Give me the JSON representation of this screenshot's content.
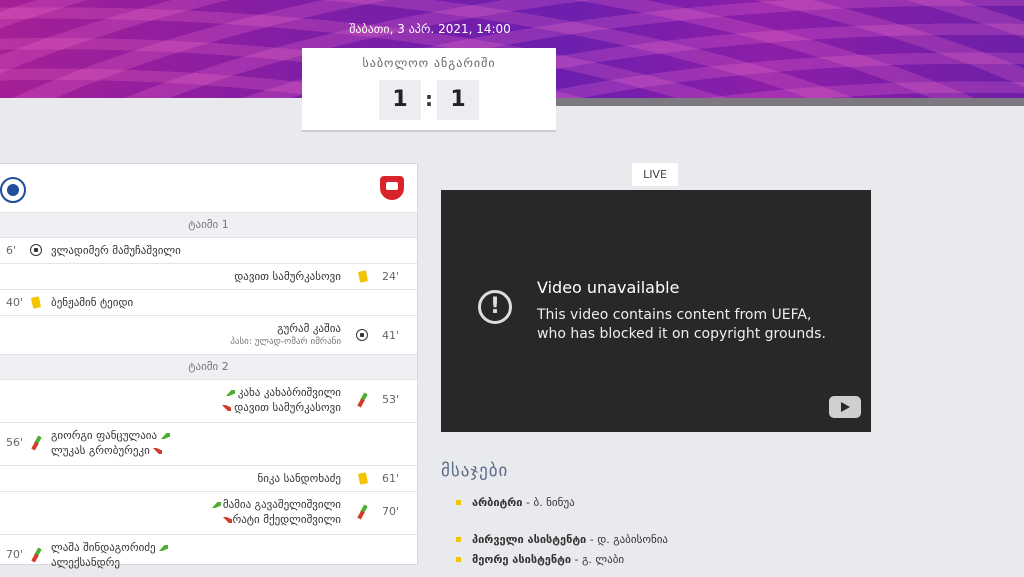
{
  "header": {
    "date": "შაბათი, 3 აპრ. 2021, 14:00",
    "score_title": "საბოლოო ანგარიში",
    "home_score": "1",
    "separator": ":",
    "away_score": "1"
  },
  "events": {
    "periods": [
      "ტაიმი 1",
      "ტაიმი 2"
    ],
    "rows": [
      {
        "side": "home",
        "minute": "6'",
        "type": "goal-icon",
        "player": "ვლადიმერ მამუჩაშვილი"
      },
      {
        "side": "away",
        "minute": "24'",
        "type": "yellow-card-icon",
        "player": "დავით სამურკასოვი"
      },
      {
        "side": "home",
        "minute": "40'",
        "type": "yellow-card-icon",
        "player": "ბენჟამინ ტეიდი"
      },
      {
        "side": "away",
        "minute": "41'",
        "type": "goal-icon",
        "player": "გურამ კაშია",
        "assist": "პასი: ულად-ომარ იმრანი"
      },
      {
        "side": "away",
        "minute": "53'",
        "type": "substitution-icon",
        "player_in": "კახა კახაბრიშვილი",
        "player_out": "დავით სამურკასოვი"
      },
      {
        "side": "home",
        "minute": "56'",
        "type": "substitution-icon",
        "player_in": "გიორგი ფანცულაია",
        "player_out": "ლუკას გრობურეკი"
      },
      {
        "side": "away",
        "minute": "61'",
        "type": "yellow-card-icon",
        "player": "ნიკა სანდოხაძე"
      },
      {
        "side": "away",
        "minute": "70'",
        "type": "substitution-icon",
        "player_in": "მამია გავაშელიშვილი",
        "player_out": "რატი მქედლიშვილი"
      },
      {
        "side": "home",
        "minute": "70'",
        "type": "substitution-icon",
        "player_in": "ლაშა შინდაგორიძე",
        "player_out": "ალექსანდრე"
      }
    ]
  },
  "live": {
    "badge": "LIVE",
    "video_title": "Video unavailable",
    "video_message": "This video contains content from UEFA, who has blocked it on copyright grounds."
  },
  "referees": {
    "title": "მსაჯები",
    "items": [
      {
        "role": "არბიტრი",
        "name": "ბ. ნინუა"
      },
      {
        "role": "პირველი ასისტენტი",
        "name": "დ. გაბისონია"
      },
      {
        "role": "მეორე ასისტენტი",
        "name": "გ. ლაბი"
      }
    ]
  },
  "colors": {
    "hero_purple": "#7a1ea8",
    "hero_magenta": "#a51f96",
    "card_yellow": "#f2c500",
    "sub_green": "#4caf32",
    "sub_red": "#d23a2c"
  }
}
